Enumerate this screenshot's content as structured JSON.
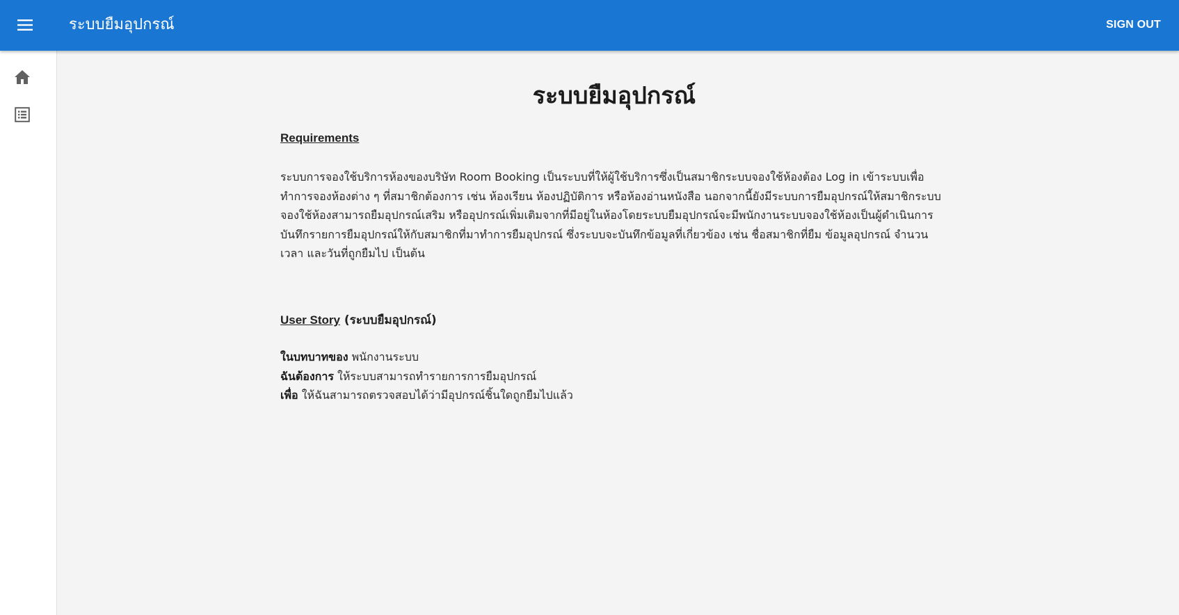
{
  "header": {
    "menu_icon": "menu-icon",
    "title": "ระบบยืมอุปกรณ์",
    "sign_out": "SIGN OUT",
    "color": "#1976d2"
  },
  "sidebar": {
    "items": [
      {
        "icon": "home-icon"
      },
      {
        "icon": "list-icon"
      }
    ]
  },
  "main": {
    "title": "ระบบยืมอุปกรณ์",
    "requirements_heading": "Requirements",
    "requirements_text": "ระบบการจองใช้บริการห้องของบริษัท Room Booking เป็นระบบที่ให้ผู้ใช้บริการซึ่งเป็นสมาชิกระบบจองใช้ห้องต้อง Log in เข้าระบบเพื่อทำการจองห้องต่าง ๆ ที่สมาชิกต้องการ เช่น ห้องเรียน ห้องปฏิบัติการ หรือห้องอ่านหนังสือ นอกจากนี้ยังมีระบบการยืมอุปกรณ์ให้สมาชิกระบบจองใช้ห้องสามารถยืมอุปกรณ์เสริม หรืออุปกรณ์เพิ่มเติมจากที่มีอยู่ในห้องโดยระบบยืมอุปกรณ์จะมีพนักงานระบบจองใช้ห้องเป็นผู้ดำเนินการบันทึกรายการยืมอุปกรณ์ให้กับสมาชิกที่มาทำการยืมอุปกรณ์ ซึ่งระบบจะบันทึกข้อมูลที่เกี่ยวข้อง เช่น ชื่อสมาชิกที่ยืม ข้อมูลอุปกรณ์ จำนวน เวลา และวันที่ถูกยืมไป เป็นต้น",
    "user_story_heading": "User Story",
    "user_story_subtitle": "(ระบบยืมอุปกรณ์)",
    "story": {
      "role_label": "ในบทบาทของ",
      "role_value": "พนักงานระบบ",
      "want_label": "ฉันต้องการ",
      "want_value": "ให้ระบบสามารถทำรายการการยืมอุปกรณ์",
      "so_label": "เพื่อ",
      "so_value": "ให้ฉันสามารถตรวจสอบได้ว่ามีอุปกรณ์ชิ้นใดถูกยืมไปแล้ว"
    }
  }
}
